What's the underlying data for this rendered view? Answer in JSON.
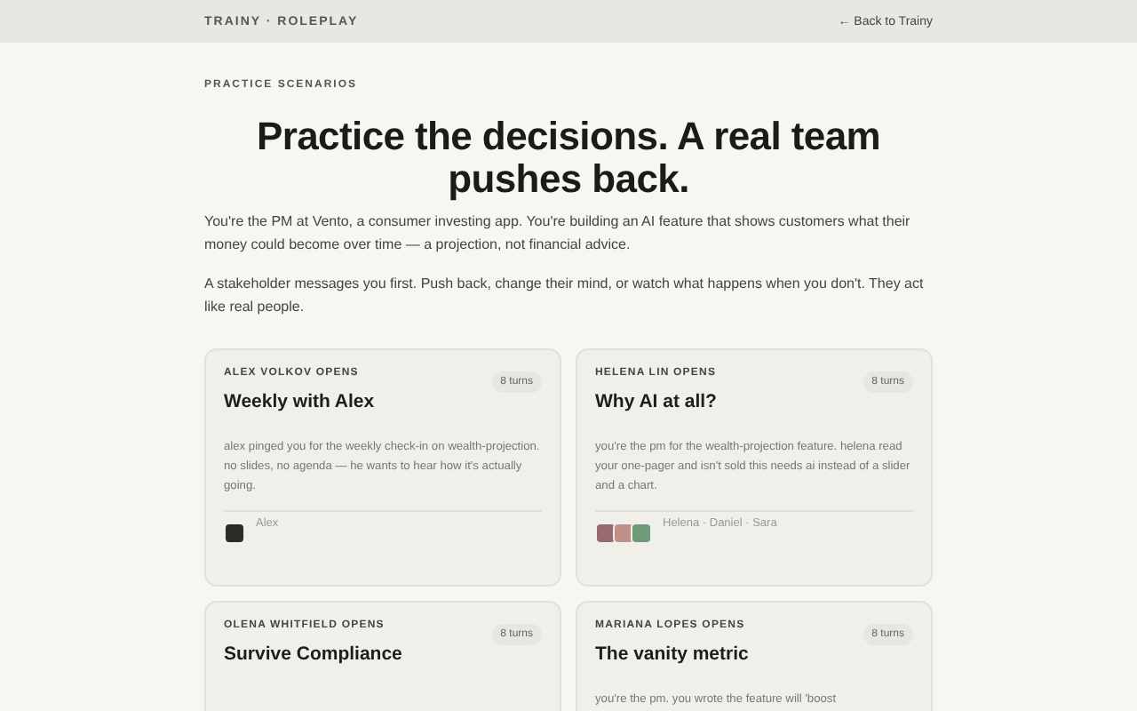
{
  "header": {
    "brand": "TRAINY · ROLEPLAY",
    "back_link": "← Back to Trainy"
  },
  "eyebrow": "PRACTICE SCENARIOS",
  "headline": "Practice the decisions. A real team pushes back.",
  "intro": [
    "You're the PM at Vento, a consumer investing app. You're building an AI feature that shows customers what their money could become over time — a projection, not financial advice.",
    "A stakeholder messages you first. Push back, change their mind, or watch what happens when you don't. They act like real people."
  ],
  "scenarios": [
    {
      "opener": "ALEX VOLKOV OPENS",
      "turns": "8 turns",
      "title": "Weekly with Alex",
      "description": "alex pinged you for the weekly check-in on wealth-projection. no slides, no agenda — he wants to hear how it's actually going.",
      "avatars": [
        {
          "color": "#2b2a27"
        }
      ],
      "people": "Alex"
    },
    {
      "opener": "HELENA LIN OPENS",
      "turns": "8 turns",
      "title": "Why AI at all?",
      "description": "you're the pm for the wealth-projection feature. helena read your one-pager and isn't sold this needs ai instead of a slider and a chart.",
      "avatars": [
        {
          "color": "#9a6a72"
        },
        {
          "color": "#c09088"
        },
        {
          "color": "#6e9a78"
        }
      ],
      "people": "Helena · Daniel · Sara"
    },
    {
      "opener": "OLENA WHITFIELD OPENS",
      "turns": "8 turns",
      "title": "Survive Compliance"
    },
    {
      "opener": "MARIANA LOPES OPENS",
      "turns": "8 turns",
      "title": "The vanity metric",
      "description": "you're the pm. you wrote the feature will 'boost"
    }
  ]
}
